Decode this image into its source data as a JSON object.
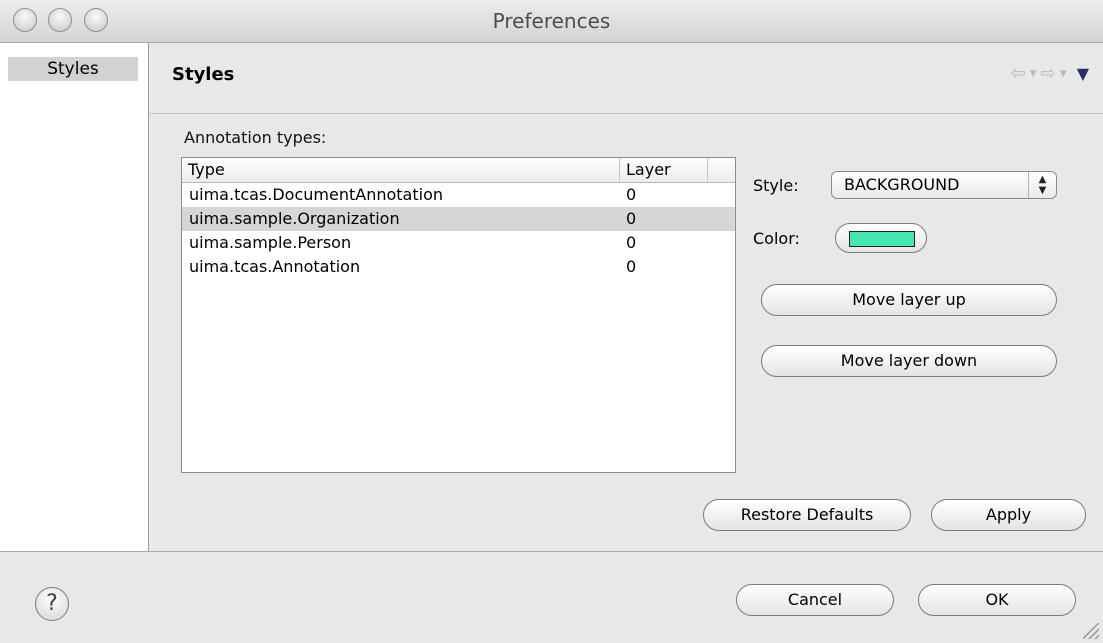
{
  "window": {
    "title": "Preferences"
  },
  "sidebar": {
    "items": [
      {
        "label": "Styles",
        "selected": true
      }
    ]
  },
  "page": {
    "title": "Styles",
    "nav": {
      "back_icon": "back-arrow-icon",
      "forward_icon": "forward-arrow-icon",
      "menu_icon": "view-menu-icon"
    },
    "annotation_label": "Annotation types:",
    "table": {
      "columns": [
        "Type",
        "Layer"
      ],
      "rows": [
        {
          "type": "uima.tcas.DocumentAnnotation",
          "layer": "0",
          "selected": false
        },
        {
          "type": "uima.sample.Organization",
          "layer": "0",
          "selected": true
        },
        {
          "type": "uima.sample.Person",
          "layer": "0",
          "selected": false
        },
        {
          "type": "uima.tcas.Annotation",
          "layer": "0",
          "selected": false
        }
      ]
    },
    "style": {
      "label": "Style:",
      "value": "BACKGROUND"
    },
    "color": {
      "label": "Color:",
      "value": "#44e6b4"
    },
    "buttons": {
      "move_up": "Move layer up",
      "move_down": "Move layer down",
      "restore": "Restore Defaults",
      "apply": "Apply"
    }
  },
  "footer": {
    "help_icon": "help-icon",
    "cancel": "Cancel",
    "ok": "OK"
  },
  "colors": {
    "selection": "#d6d6d6",
    "accent": "#2c2c6a",
    "swatch": "#44e6b4"
  }
}
